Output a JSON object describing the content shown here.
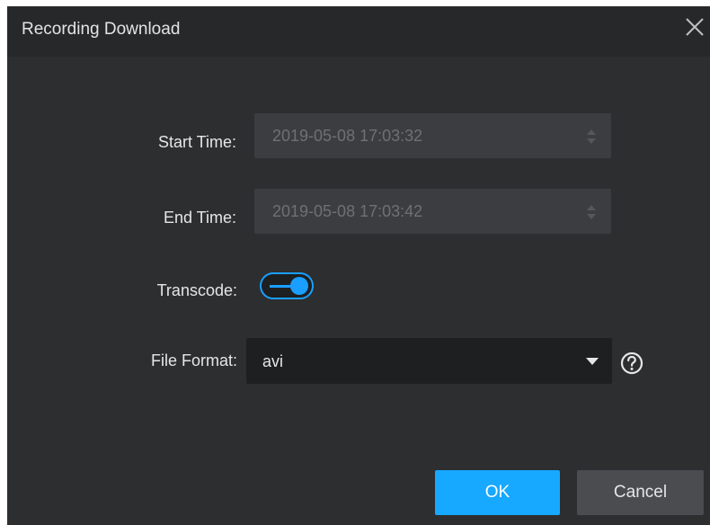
{
  "dialog": {
    "title": "Recording Download",
    "close_icon": "close-icon"
  },
  "form": {
    "start_time": {
      "label": "Start Time:",
      "value": "2019-05-08 17:03:32"
    },
    "end_time": {
      "label": "End Time:",
      "value": "2019-05-08 17:03:42"
    },
    "transcode": {
      "label": "Transcode:",
      "enabled": true
    },
    "file_format": {
      "label": "File Format:",
      "selected": "avi",
      "help_icon": "question-circle-icon"
    }
  },
  "buttons": {
    "ok_label": "OK",
    "cancel_label": "Cancel"
  },
  "colors": {
    "accent": "#17a8ff",
    "dialog_bg": "#2d2e30",
    "title_bg": "#27282a",
    "field_disabled": "#3c3d40",
    "field_dark": "#1e1f21"
  }
}
